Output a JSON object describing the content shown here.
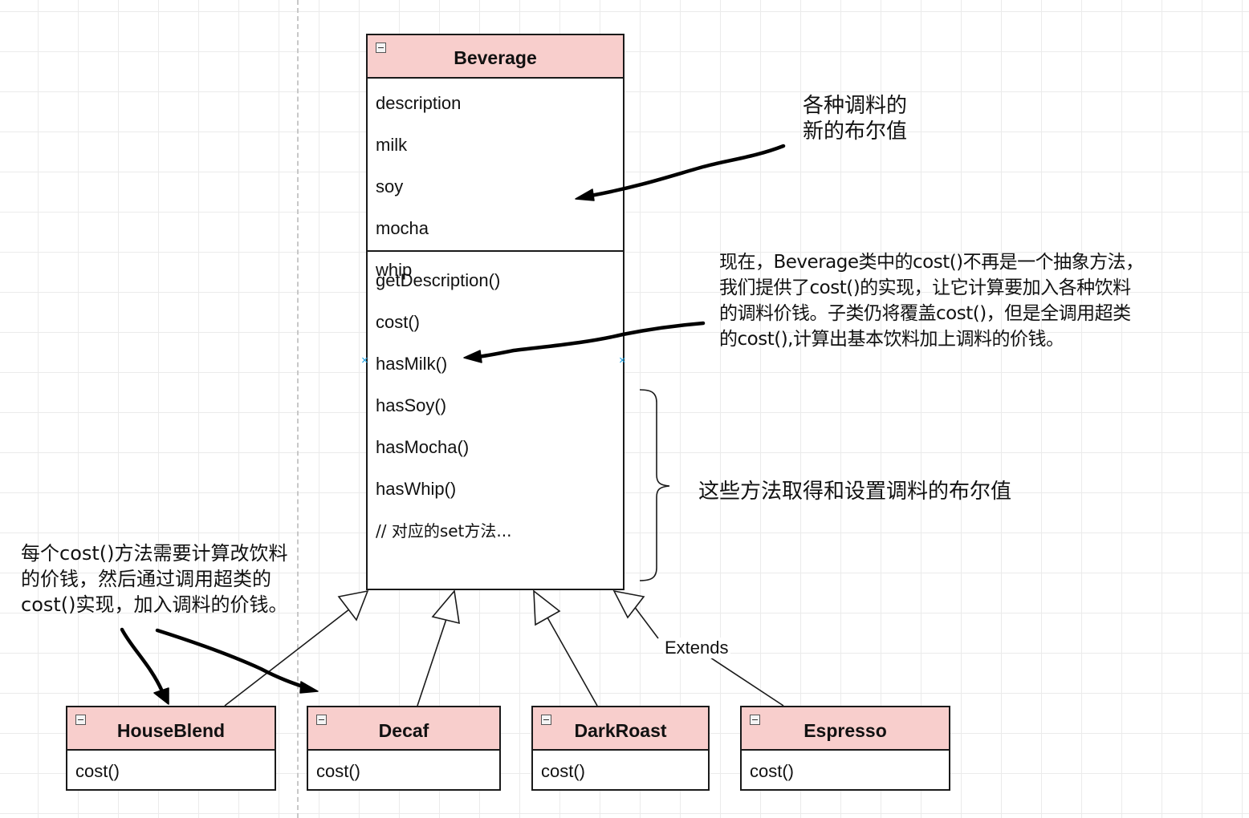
{
  "beverage": {
    "name": "Beverage",
    "attributes": [
      "description",
      "milk",
      "soy",
      "mocha",
      "whip"
    ],
    "methods": [
      "getDescription()",
      "cost()",
      "hasMilk()",
      "hasSoy()",
      "hasMocha()",
      "hasWhip()",
      "// 对应的set方法..."
    ]
  },
  "subclasses": [
    {
      "name": "HouseBlend",
      "method": "cost()"
    },
    {
      "name": "Decaf",
      "method": "cost()"
    },
    {
      "name": "DarkRoast",
      "method": "cost()"
    },
    {
      "name": "Espresso",
      "method": "cost()"
    }
  ],
  "edge_label": "Extends",
  "annotations": {
    "booleans": [
      "各种调料的",
      "新的布尔值"
    ],
    "cost_note": [
      "现在，Beverage类中的cost()不再是一个抽象方法，",
      "我们提供了cost()的实现，让它计算要加入各种饮料",
      "的调料价钱。子类仍将覆盖cost()，但是全调用超类",
      "的cost(),计算出基本饮料加上调料的价钱。"
    ],
    "methods_note": "这些方法取得和设置调料的布尔值",
    "subclass_note": [
      "每个cost()方法需要计算改饮料",
      "的价钱，然后通过调用超类的",
      "cost()实现，加入调料的价钱。"
    ]
  },
  "colors": {
    "header_fill": "#f8cecc",
    "border": "#1a1a1a",
    "grid": "#ebebeb",
    "connection_marker": "#1ba1e2"
  }
}
